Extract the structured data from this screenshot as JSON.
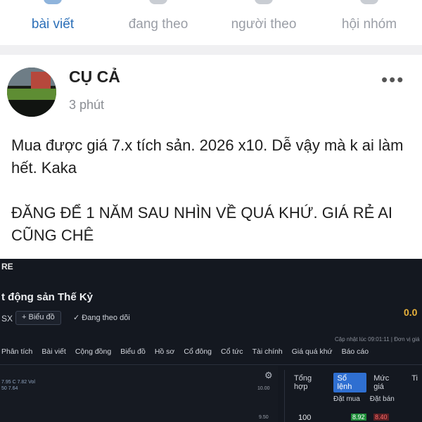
{
  "tabs": [
    {
      "label": "bài viết",
      "active": true
    },
    {
      "label": "đang theo",
      "active": false
    },
    {
      "label": "người theo",
      "active": false
    },
    {
      "label": "hội nhóm",
      "active": false
    }
  ],
  "post": {
    "author": "CỤ CẢ",
    "time": "3 phút",
    "more_icon": "•••",
    "paragraphs": [
      "Mua được giá 7.x tích sản. 2026 x10. Dễ vậy mà k ai làm hết. Kaka",
      "ĐĂNG ĐỂ 1 NĂM SAU NHÌN VỀ QUÁ KHỨ. GIÁ RẺ AI CŨNG CHÊ"
    ]
  },
  "screenshot": {
    "brand": "RE",
    "stock_name": "t động sản Thế Kỷ",
    "price": "0.0",
    "exchange": "SX",
    "chart_button": "+ Biểu đồ",
    "follow_label": "✓ Đang theo dõi",
    "updated": "Cập nhật lúc 09:01:11 | Đơn vị giá",
    "nav_items": [
      "Phân tích",
      "Bài viết",
      "Cộng đồng",
      "Biểu đồ",
      "Hồ sơ",
      "Cổ đông",
      "Cổ tức",
      "Tài chính",
      "Giá quá khứ",
      "Báo cáo"
    ],
    "ohlc_line1": "7.95 C 7.82 Vol",
    "ohlc_line2": "50 7.64",
    "axis_top": "10.00",
    "axis_bottom": "9.50",
    "orderbook_tabs": [
      {
        "label": "Tổng hợp",
        "active": false
      },
      {
        "label": "Sổ lệnh",
        "active": true
      },
      {
        "label": "Mức giá",
        "active": false
      },
      {
        "label": "Ti",
        "active": false
      }
    ],
    "col_buy": "Đặt mua",
    "col_sell": "Đặt bán",
    "row_volume": "100",
    "row_buy": "8.92",
    "row_sell": "8.40"
  },
  "colors": {
    "active_tab": "#2b6fb8",
    "inactive_tab": "#9a9ea6",
    "screenshot_bg": "#141820",
    "price": "#e8b23b"
  }
}
